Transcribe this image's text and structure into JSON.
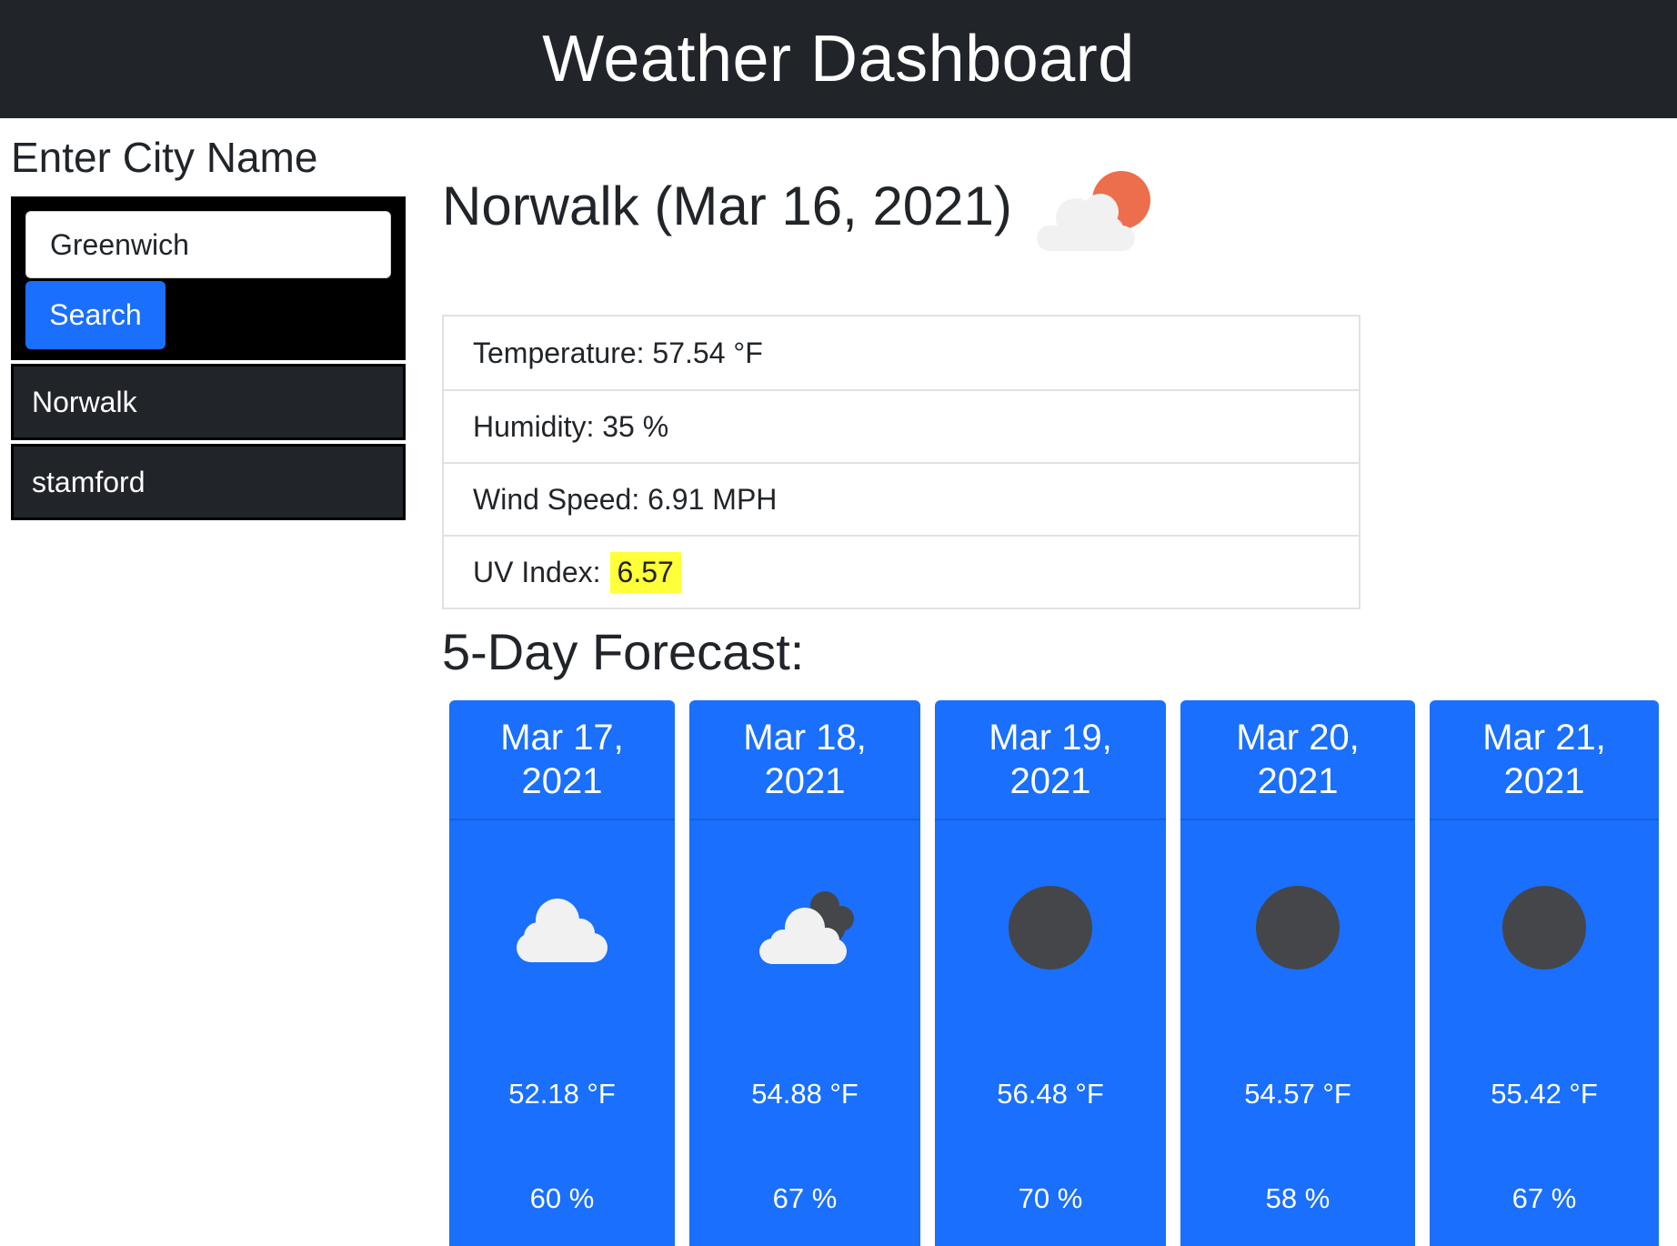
{
  "header": {
    "title": "Weather Dashboard"
  },
  "sidebar": {
    "heading": "Enter City Name",
    "search_input_value": "Greenwich",
    "search_button_label": "Search",
    "history": [
      "Norwalk",
      "stamford"
    ]
  },
  "current": {
    "title": "Norwalk (Mar 16, 2021)",
    "icon": "partly-cloudy-day-icon",
    "temperature": "Temperature: 57.54 °F",
    "humidity": "Humidity: 35 %",
    "wind": "Wind Speed: 6.91 MPH",
    "uv_label": "UV Index:",
    "uv_value": "6.57",
    "uv_color": "#ffff3a"
  },
  "forecast": {
    "heading": "5-Day Forecast:",
    "card_color": "#1a6ffc",
    "days": [
      {
        "date_line1": "Mar 17,",
        "date_line2": "2021",
        "icon": "cloud-icon",
        "temp": "52.18 °F",
        "humidity": "60 %"
      },
      {
        "date_line1": "Mar 18,",
        "date_line2": "2021",
        "icon": "broken-clouds-icon",
        "temp": "54.88 °F",
        "humidity": "67 %"
      },
      {
        "date_line1": "Mar 19,",
        "date_line2": "2021",
        "icon": "clear-night-icon",
        "temp": "56.48 °F",
        "humidity": "70 %"
      },
      {
        "date_line1": "Mar 20,",
        "date_line2": "2021",
        "icon": "clear-night-icon",
        "temp": "54.57 °F",
        "humidity": "58 %"
      },
      {
        "date_line1": "Mar 21,",
        "date_line2": "2021",
        "icon": "clear-night-icon",
        "temp": "55.42 °F",
        "humidity": "67 %"
      }
    ]
  }
}
